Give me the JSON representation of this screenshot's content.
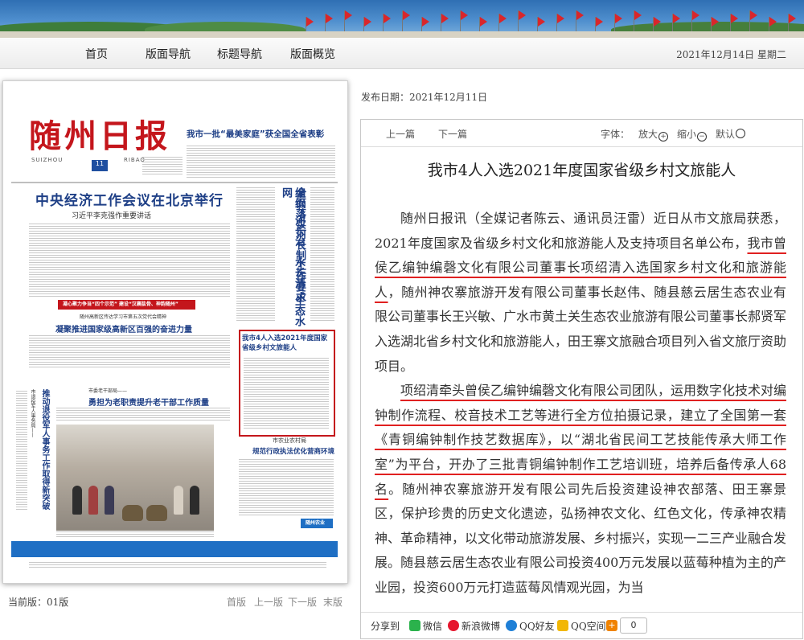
{
  "nav": {
    "items": [
      "首页",
      "版面导航",
      "标题导航",
      "版面概览"
    ],
    "date": "2021年12月14日  星期二"
  },
  "newspaper": {
    "masthead": "随州日报",
    "pinyin_left": "SUIZHOU",
    "pinyin_right": "RIBAO",
    "issue_no": "11",
    "top_headline": "我市一批“最美家庭”获全国全省表彰",
    "lead_headline": "中央经济工作会议在北京举行",
    "lead_sub": "习近平李克强作重要讲话",
    "vertical_headline_1": "全面落实河长制工作要求",
    "vertical_headline_2": "编织“河长治、水长清”生态水网",
    "red_strip": "凝心聚力争当“四个示范” 建设“汉襄肱骨、神韵随州”",
    "mid_headline": "凝聚推进国家级高新区百强的奋进力量",
    "mid_kicker": "随州高新区传达学习市第五次党代会精神",
    "boxed_headline": "我市4人入选2021年度国家省级乡村文旅能人",
    "left_vertical": "推动退役军人事务工作取得新突破",
    "left_vertical_kicker": "市退役军人事务局——",
    "elder_kicker": "市委老干部局——",
    "elder_headline": "勇担为老职责提升老干部工作质量",
    "right_small_kicker": "市农业农村局",
    "right_small_headline": "规范行政执法优化营商环境",
    "corner_tag": "随州农业"
  },
  "left_footer": {
    "current": "当前版：01版",
    "links": [
      "首版",
      "上一版",
      "下一版",
      "末版"
    ]
  },
  "pub_date": "发布日期：2021年12月11日",
  "toolbar": {
    "prev": "上一篇",
    "next": "下一篇",
    "font_label": "字体：",
    "bigger": "放大",
    "smaller": "缩小",
    "default": "默认"
  },
  "article": {
    "title": "我市4人入选2021年度国家省级乡村文旅能人",
    "p1_a": "随州日报讯（全媒记者陈云、通讯员汪雷）近日从市文旅局获悉，2021年度国家及省级乡村文化和旅游能人及支持项目名单公布，",
    "p1_u": "我市曾侯乙编钟编磬文化有限公司董事长项绍清入选国家乡村文化和旅游能人",
    "p1_b": "，随州神农寨旅游开发有限公司董事长赵伟、随县慈云居生态农业有限公司董事长王兴敏、广水市黄土关生态农业旅游有限公司董事长郝贤军入选湖北省乡村文化和旅游能人，田王寨文旅融合项目列入省文旅厅资助项目。",
    "p2_u": "项绍清牵头曾侯乙编钟编磬文化有限公司团队，运用数字化技术对编钟制作流程、校音技术工艺等进行全方位拍摄记录，建立了全国第一套《青铜编钟制作技艺数据库》，以“湖北省民间工艺技能传承大师工作室”为平台，开办了三批青铜编钟制作工艺培训班，培养后备传承人68名",
    "p2_b": "。随州神农寨旅游开发有限公司先后投资建设神农部落、田王寨景区，保护珍贵的历史文化遗迹，弘扬神农文化、红色文化，传承神农精神、革命精神，以文化带动旅游发展、乡村振兴，实现一二三产业融合发展。随县慈云居生态农业有限公司投资400万元发展以蓝莓种植为主的产业园，投资600万元打造蓝莓风情观光园，为当"
  },
  "share": {
    "label": "分享到",
    "wechat": "微信",
    "weibo": "新浪微博",
    "qq": "QQ好友",
    "qzone": "QQ空间",
    "count": "0"
  },
  "colors": {
    "accent_red": "#c4161c",
    "underline_red": "#e02020",
    "masthead_blue": "#1e3f86"
  }
}
